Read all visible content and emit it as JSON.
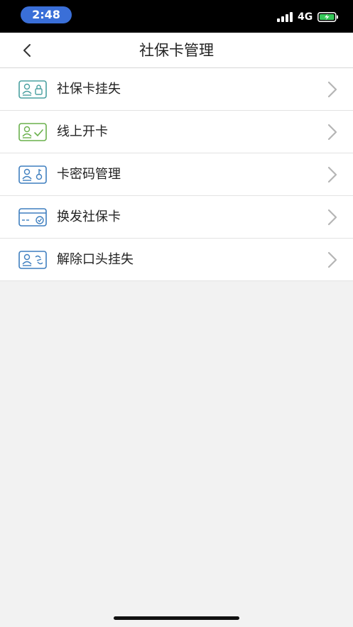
{
  "status_bar": {
    "time": "2:48",
    "network": "4G",
    "icons": [
      "signal-icon",
      "battery-charging-icon"
    ]
  },
  "nav": {
    "title": "社保卡管理",
    "back_icon": "chevron-left-icon"
  },
  "menu": {
    "items": [
      {
        "label": "社保卡挂失",
        "icon": "card-lock-icon",
        "color": "#4aa0a0"
      },
      {
        "label": "线上开卡",
        "icon": "card-check-icon",
        "color": "#6ab04c"
      },
      {
        "label": "卡密码管理",
        "icon": "card-key-icon",
        "color": "#3f7fbf"
      },
      {
        "label": "换发社保卡",
        "icon": "card-reissue-icon",
        "color": "#3f7fbf"
      },
      {
        "label": "解除口头挂失",
        "icon": "card-unlink-icon",
        "color": "#3f7fbf"
      }
    ]
  },
  "colors": {
    "time_pill": "#3a6fd8",
    "background": "#f2f2f2",
    "chevron": "#b5b5b5"
  }
}
